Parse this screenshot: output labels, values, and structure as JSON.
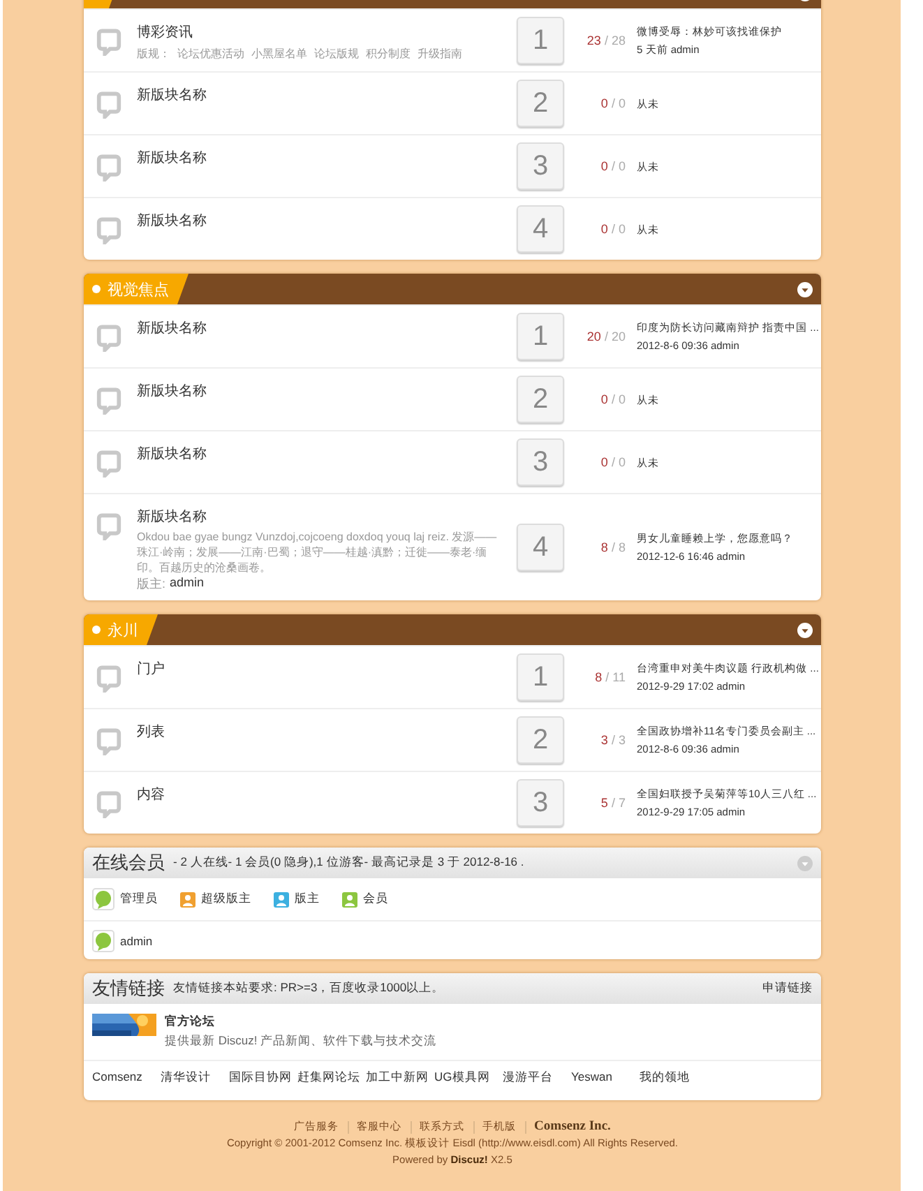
{
  "sections": [
    {
      "rows": [
        {
          "name": "博彩资讯",
          "rules_label": "版规：",
          "rules": [
            "论坛优惠活动",
            "小黑屋名单",
            "论坛版规",
            "积分制度",
            "升级指南"
          ],
          "number": "1",
          "today": "23",
          "separator": "/",
          "total": "28",
          "last_post": [
            "微博受辱：林妙可该找谁保护",
            "5 天前 admin"
          ]
        },
        {
          "name": "新版块名称",
          "number": "2",
          "today": "0",
          "separator": "/",
          "total": "0",
          "last_post": [
            "从未"
          ]
        },
        {
          "name": "新版块名称",
          "number": "3",
          "today": "0",
          "separator": "/",
          "total": "0",
          "last_post": [
            "从未"
          ]
        },
        {
          "name": "新版块名称",
          "number": "4",
          "today": "0",
          "separator": "/",
          "total": "0",
          "last_post": [
            "从未"
          ]
        }
      ]
    },
    {
      "title": "视觉焦点",
      "rows": [
        {
          "name": "新版块名称",
          "number": "1",
          "today": "20",
          "separator": "/",
          "total": "20",
          "last_post": [
            "印度为防长访问藏南辩护 指责中国 ...",
            "2012-8-6 09:36 admin"
          ]
        },
        {
          "name": "新版块名称",
          "number": "2",
          "today": "0",
          "separator": "/",
          "total": "0",
          "last_post": [
            "从未"
          ]
        },
        {
          "name": "新版块名称",
          "number": "3",
          "today": "0",
          "separator": "/",
          "total": "0",
          "last_post": [
            "从未"
          ]
        },
        {
          "name": "新版块名称",
          "description": "Okdou bae gyae bungz Vunzdoj,cojcoeng doxdoq youq laj reiz. 发源——珠江·岭南；发展——江南·巴蜀；退守——桂越·滇黔；迁徙——泰老·缅印。百越历史的沧桑画卷。",
          "moderator_label": "版主:",
          "moderator": "admin",
          "number": "4",
          "today": "8",
          "separator": "/",
          "total": "8",
          "last_post": [
            "男女儿童睡赖上学，您愿意吗？",
            "2012-12-6 16:46 admin"
          ]
        }
      ]
    },
    {
      "title": "永川",
      "rows": [
        {
          "name": "门户",
          "number": "1",
          "today": "8",
          "separator": "/",
          "total": "11",
          "last_post": [
            "台湾重申对美牛肉议题 行政机构做 ...",
            "2012-9-29 17:02 admin"
          ]
        },
        {
          "name": "列表",
          "number": "2",
          "today": "3",
          "separator": "/",
          "total": "3",
          "last_post": [
            "全国政协增补11名专门委员会副主 ...",
            "2012-8-6 09:36 admin"
          ]
        },
        {
          "name": "内容",
          "number": "3",
          "today": "5",
          "separator": "/",
          "total": "7",
          "last_post": [
            "全国妇联授予吴菊萍等10人三八红 ...",
            "2012-9-29 17:05 admin"
          ]
        }
      ]
    }
  ],
  "online": {
    "title": "在线会员",
    "summary": "- 2 人在线- 1 会员(0 隐身),1 位游客- 最高记录是 3 于 2012-8-16 .",
    "legend": [
      {
        "kind": "bubble",
        "label": "管理员",
        "color": "#8cc63f"
      },
      {
        "kind": "person",
        "label": "超级版主",
        "color": "#f0a030"
      },
      {
        "kind": "person",
        "label": "版主",
        "color": "#3cb0e0"
      },
      {
        "kind": "person",
        "label": "会员",
        "color": "#8cc63f"
      }
    ],
    "users": [
      {
        "kind": "bubble",
        "name": "admin",
        "color": "#8cc63f"
      }
    ]
  },
  "links": {
    "title": "友情链接",
    "note": "友情链接本站要求: PR>=3，百度收录1000以上。",
    "apply": "申请链接",
    "featured": {
      "kind": "picture",
      "title": "官方论坛",
      "description": "提供最新 Discuz! 产品新闻、软件下载与技术交流"
    },
    "items": [
      "Comsenz",
      "清华设计",
      "国际目协网",
      "赶集网论坛",
      "加工中新网",
      "UG模具网",
      "漫游平台",
      "Yeswan",
      "我的领地"
    ]
  },
  "footer": {
    "links": [
      "广告服务",
      "客服中心",
      "联系方式",
      "手机版"
    ],
    "company": "Comsenz Inc.",
    "copyright": "Copyright © 2001-2012 Comsenz Inc. 模板设计 Eisdl (http://www.eisdl.com) All Rights Reserved.",
    "powered": "Powered by **Discuz!** X2.5"
  }
}
